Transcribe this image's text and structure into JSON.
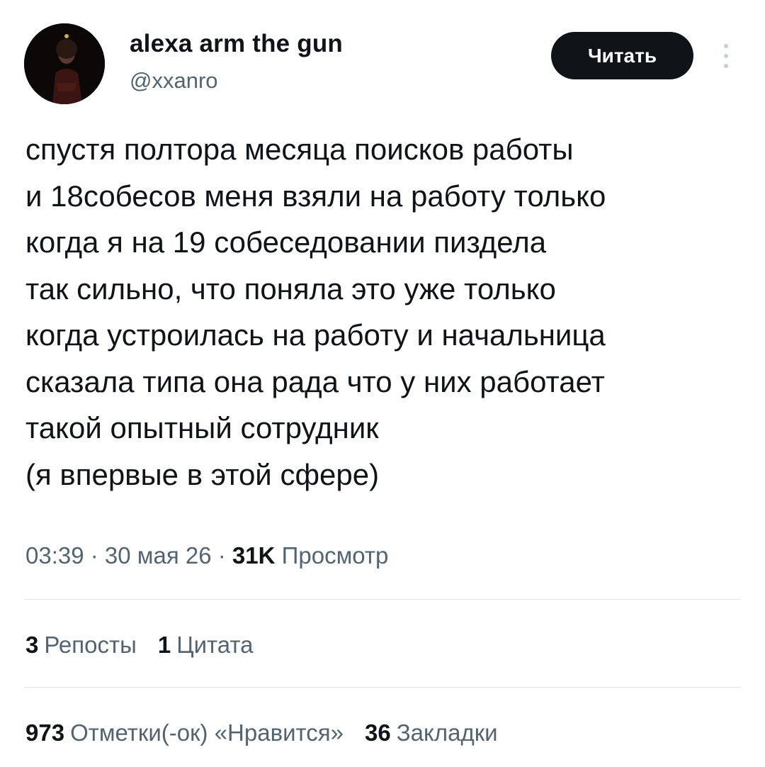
{
  "user": {
    "display_name": "alexa arm the gun",
    "handle": "@xxanro"
  },
  "actions": {
    "follow_label": "Читать",
    "more_icon": "more-vertical-icon"
  },
  "tweet": {
    "lines": [
      "спустя полтора месяца поисков работы",
      "и 18собесов меня взяли на работу только",
      "когда я на 19 собеседовании пиздела",
      "так сильно, что поняла это уже только",
      "когда устроилась на работу и начальница",
      "сказала типа она рада что у них работает",
      "такой опытный сотрудник",
      "(я впервые в этой сфере)"
    ]
  },
  "meta": {
    "time": "03:39",
    "sep1": " · ",
    "date": "30 мая 26",
    "sep2": " · ",
    "views_count": "31K",
    "views_label": "Просмотр"
  },
  "stats": {
    "reposts": {
      "count": "3",
      "label": "Репосты"
    },
    "quotes": {
      "count": "1",
      "label": "Цитата"
    },
    "likes": {
      "count": "973",
      "label": "Отметки(-ок) «Нравится»"
    },
    "bookmarks": {
      "count": "36",
      "label": "Закладки"
    }
  },
  "colors": {
    "text_primary": "#0f1419",
    "text_secondary": "#536471",
    "button_bg": "#0f1419",
    "divider": "#e1e5e8"
  }
}
